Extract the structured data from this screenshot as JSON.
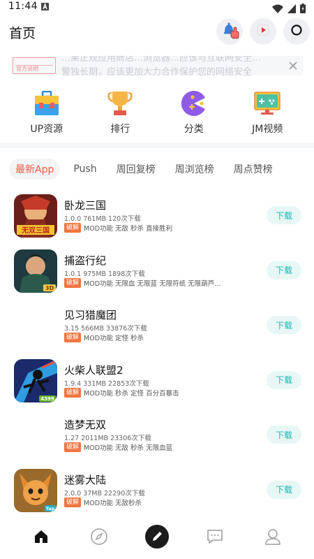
{
  "status": {
    "time": "11:44"
  },
  "header": {
    "title": "首页"
  },
  "notice": {
    "badge_text": "官方说明",
    "text_line1": "…果正规应用商店…浏览器…应该与互联网安全…",
    "text_line2": "警独长期，应该更加大力合作保护您的网络安全"
  },
  "quick_nav": [
    {
      "label": "UP资源",
      "icon": "briefcase-icon"
    },
    {
      "label": "排行",
      "icon": "trophy-icon"
    },
    {
      "label": "分类",
      "icon": "pacman-icon"
    },
    {
      "label": "JM视频",
      "icon": "monitor-icon"
    }
  ],
  "tabs": [
    {
      "label": "最新App",
      "active": true
    },
    {
      "label": "Push",
      "active": false
    },
    {
      "label": "周回复榜",
      "active": false
    },
    {
      "label": "周浏览榜",
      "active": false
    },
    {
      "label": "周点赞榜",
      "active": false
    }
  ],
  "apps": [
    {
      "name": "卧龙三国",
      "meta": "1.0.0 761MB 120次下载",
      "badge": "破解",
      "features": "MOD功能 无敌 秒杀 直接胜利",
      "button": "下载",
      "icon_label": "无双三国"
    },
    {
      "name": "捕盗行纪",
      "meta": "1.0.1 975MB 1898次下载",
      "badge": "破解",
      "features": "MOD功能 无限血 无限蓝 无限符纸 无限葫芦…",
      "button": "下载",
      "icon_label": "3D"
    },
    {
      "name": "见习猎魔团",
      "meta": "3.15 566MB 33876次下载",
      "badge": "破解",
      "features": "MOD功能 定怪 秒杀",
      "button": "下载",
      "icon_label": ""
    },
    {
      "name": "火柴人联盟2",
      "meta": "1.9.4 331MB 22853次下载",
      "badge": "破解",
      "features": "MOD功能 秒杀 定怪 百分百暴击",
      "button": "下载",
      "icon_label": "4399"
    },
    {
      "name": "造梦无双",
      "meta": "1.27 2011MB 23306次下载",
      "badge": "破解",
      "features": "MOD功能 无敌 秒杀 无限血蓝",
      "button": "下载",
      "icon_label": ""
    },
    {
      "name": "迷雾大陆",
      "meta": "2.0.0 37MB 22290次下载",
      "badge": "破解",
      "features": "MOD功能 无敌秒杀",
      "button": "下载",
      "icon_label": "Tap"
    }
  ],
  "bottom_nav": [
    {
      "name": "home-icon"
    },
    {
      "name": "compass-icon"
    },
    {
      "name": "pen-icon"
    },
    {
      "name": "chat-icon"
    },
    {
      "name": "profile-icon"
    }
  ],
  "colors": {
    "accent": "#f15a42",
    "download_bg": "#e7f7f6",
    "download_text": "#18b7b4",
    "crack_badge": "#f2743f"
  }
}
